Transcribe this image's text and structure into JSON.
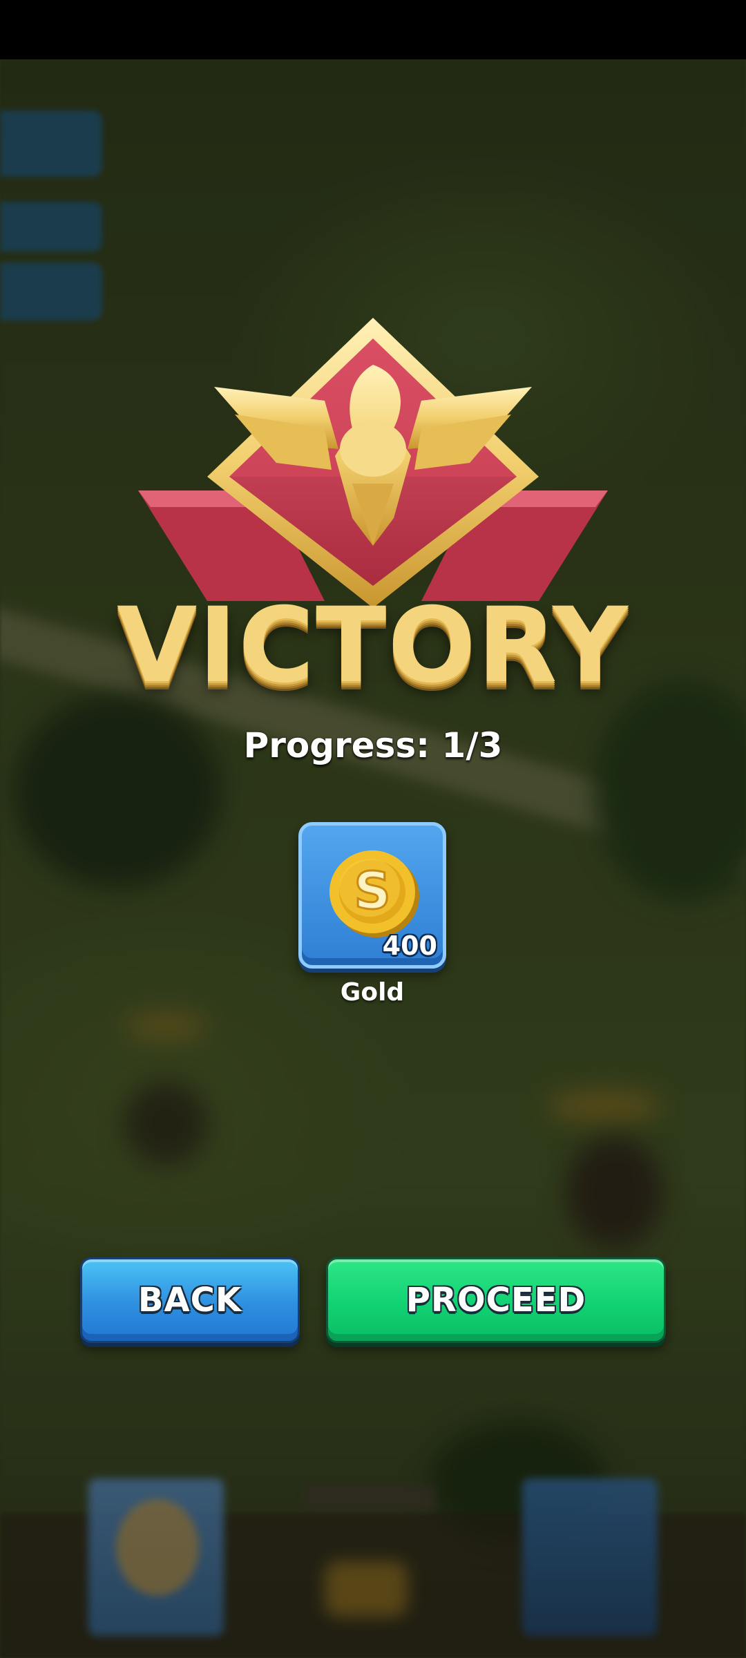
{
  "banner": {
    "title": "VICTORY",
    "progress_label": "Progress: 1/3"
  },
  "rewards": [
    {
      "name": "Gold",
      "quantity": "400",
      "icon": "gold-coin-icon"
    }
  ],
  "buttons": {
    "back_label": "BACK",
    "proceed_label": "PROCEED"
  },
  "colors": {
    "victory_gold": "#f4d47c",
    "emblem_red": "#c5414e",
    "back_blue": "#2e8fe0",
    "proceed_green": "#11d273",
    "reward_card_blue": "#3a8de0"
  }
}
